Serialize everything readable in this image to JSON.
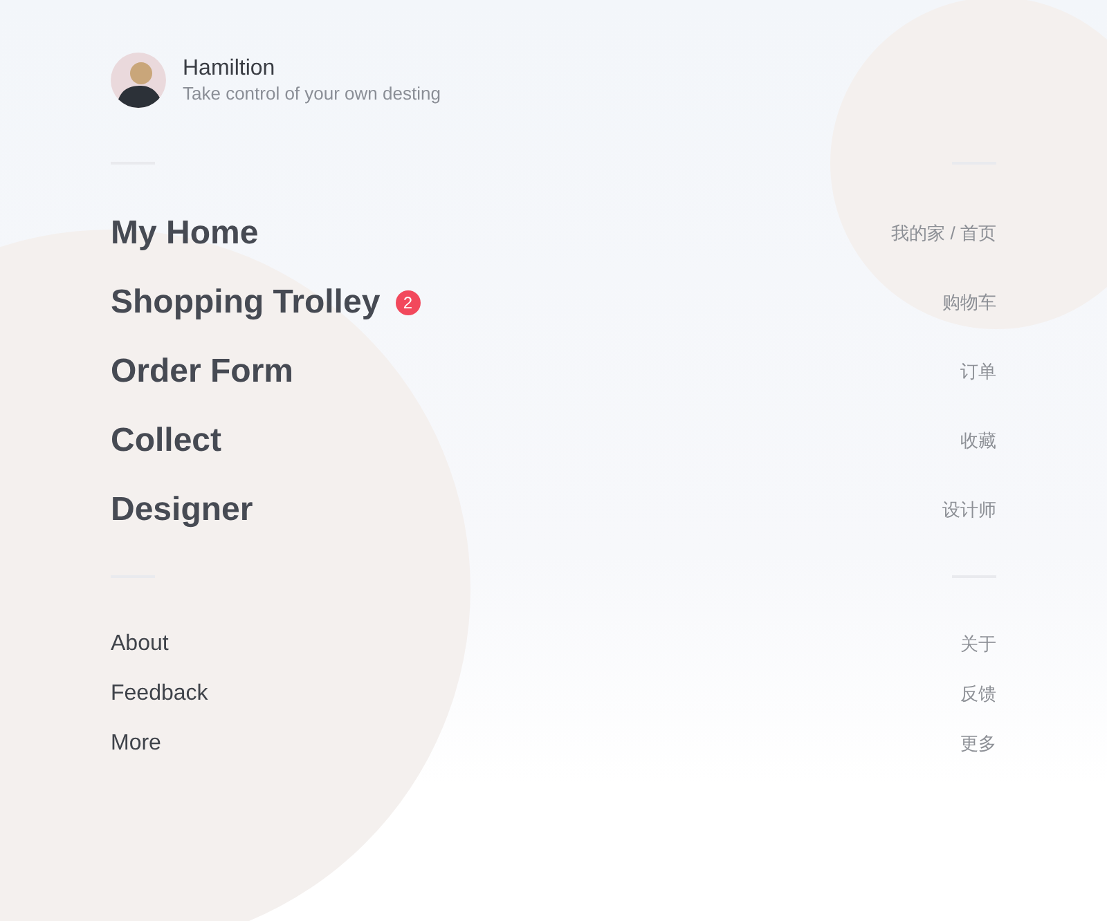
{
  "profile": {
    "name": "Hamiltion",
    "tagline": "Take control of your own desting"
  },
  "main_menu": [
    {
      "label": "My Home",
      "translation": "我的家 / 首页"
    },
    {
      "label": "Shopping Trolley",
      "badge": "2",
      "translation": "购物车"
    },
    {
      "label": "Order Form",
      "translation": "订单"
    },
    {
      "label": "Collect",
      "translation": "收藏"
    },
    {
      "label": "Designer",
      "translation": "设计师"
    }
  ],
  "secondary_menu": [
    {
      "label": "About",
      "translation": "关于"
    },
    {
      "label": "Feedback",
      "translation": "反馈"
    },
    {
      "label": "More",
      "translation": "更多"
    }
  ]
}
